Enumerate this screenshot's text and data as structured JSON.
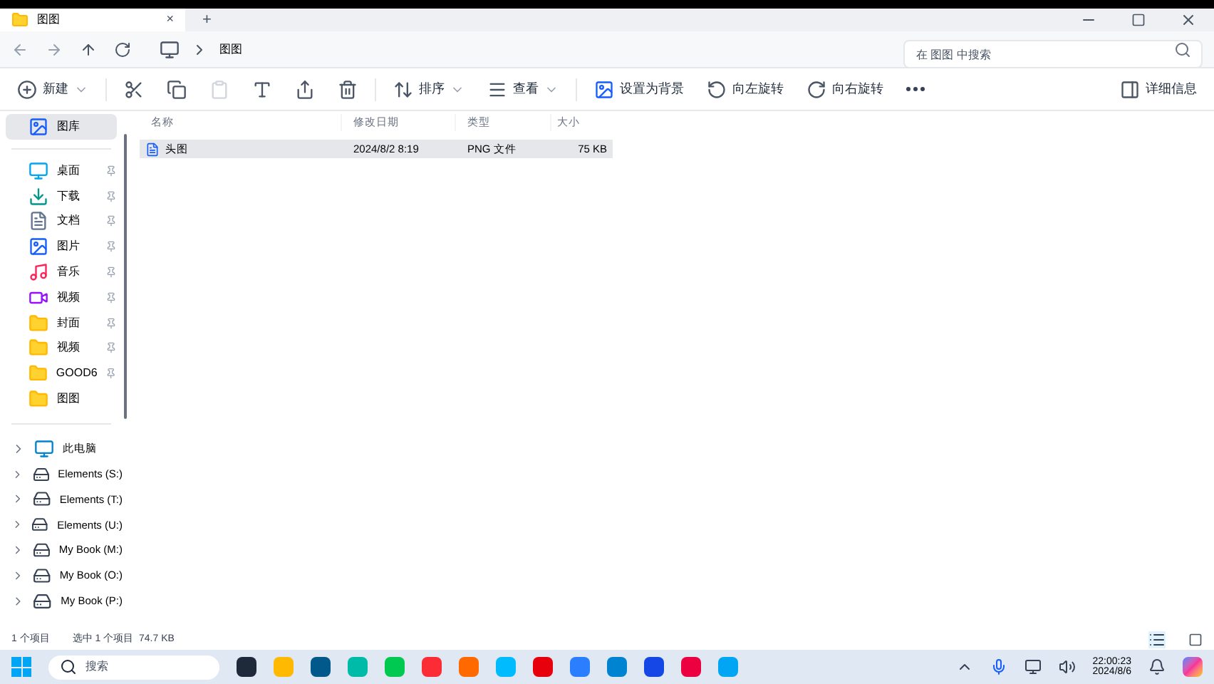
{
  "tab": {
    "title": "图图",
    "close": "×",
    "new": "+"
  },
  "address": {
    "crumb": "图图",
    "search_placeholder": "在 图图 中搜索"
  },
  "toolbar": {
    "new": "新建",
    "sort": "排序",
    "view": "查看",
    "set_bg": "设置为背景",
    "rotate_left": "向左旋转",
    "rotate_right": "向右旋转",
    "details": "详细信息"
  },
  "sidebar": {
    "gallery": {
      "label": "图库",
      "selected": true
    },
    "quick": [
      {
        "label": "桌面",
        "kind": "desktop"
      },
      {
        "label": "下载",
        "kind": "download"
      },
      {
        "label": "文档",
        "kind": "document"
      },
      {
        "label": "图片",
        "kind": "picture"
      },
      {
        "label": "音乐",
        "kind": "music"
      },
      {
        "label": "视频",
        "kind": "video"
      },
      {
        "label": "封面",
        "kind": "folder"
      },
      {
        "label": "视频",
        "kind": "folder"
      },
      {
        "label": "GOOD6",
        "kind": "folder"
      },
      {
        "label": "图图",
        "kind": "folder"
      }
    ],
    "drives": [
      {
        "label": "此电脑",
        "kind": "pc"
      },
      {
        "label": "Elements (S:)",
        "kind": "drive"
      },
      {
        "label": "Elements (T:)",
        "kind": "drive"
      },
      {
        "label": "Elements (U:)",
        "kind": "drive"
      },
      {
        "label": "My Book (M:)",
        "kind": "drive"
      },
      {
        "label": "My Book (O:)",
        "kind": "drive"
      },
      {
        "label": "My Book (P:)",
        "kind": "drive"
      }
    ]
  },
  "table": {
    "columns": [
      "名称",
      "修改日期",
      "类型",
      "大小"
    ],
    "rows": [
      {
        "name": "头图",
        "date": "2024/8/2 8:19",
        "type": "PNG 文件",
        "size": "75 KB",
        "selected": true
      }
    ]
  },
  "status_bar": {
    "count": "1 个项目",
    "selection": "选中 1 个项目  74.7 KB"
  },
  "taskbar": {
    "search": "搜索",
    "time": "22:00:23",
    "date": "2024/8/6"
  }
}
